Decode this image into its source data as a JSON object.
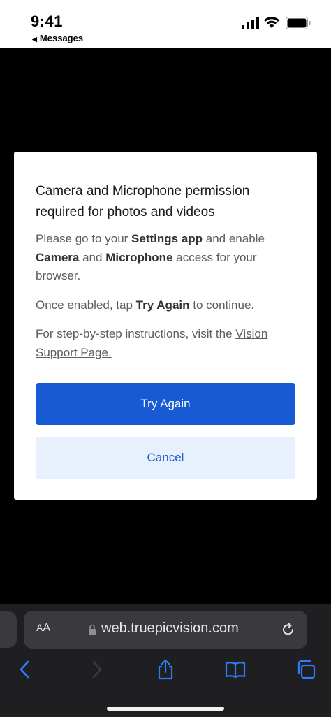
{
  "status": {
    "time": "9:41",
    "back_app": "Messages"
  },
  "dialog": {
    "title": "Camera and Microphone permission required for photos and videos",
    "p1_prefix": "Please go to your ",
    "p1_settings": "Settings app",
    "p1_mid": " and enable ",
    "p1_camera": "Camera",
    "p1_and": " and ",
    "p1_microphone": "Microphone",
    "p1_suffix": " access for your browser.",
    "p2_prefix": "Once enabled, tap ",
    "p2_try": "Try Again",
    "p2_suffix": " to continue.",
    "p3_prefix": "For step-by-step instructions, visit the ",
    "p3_link": "Vision Support Page.",
    "primary_button": "Try Again",
    "secondary_button": "Cancel"
  },
  "browser": {
    "aa_label_big": "A",
    "aa_label_small": "A",
    "url": "web.truepicvision.com"
  },
  "colors": {
    "accent": "#175ad4",
    "secondary_bg": "#e8f1fb",
    "toolbar_icon": "#2f7df6"
  }
}
